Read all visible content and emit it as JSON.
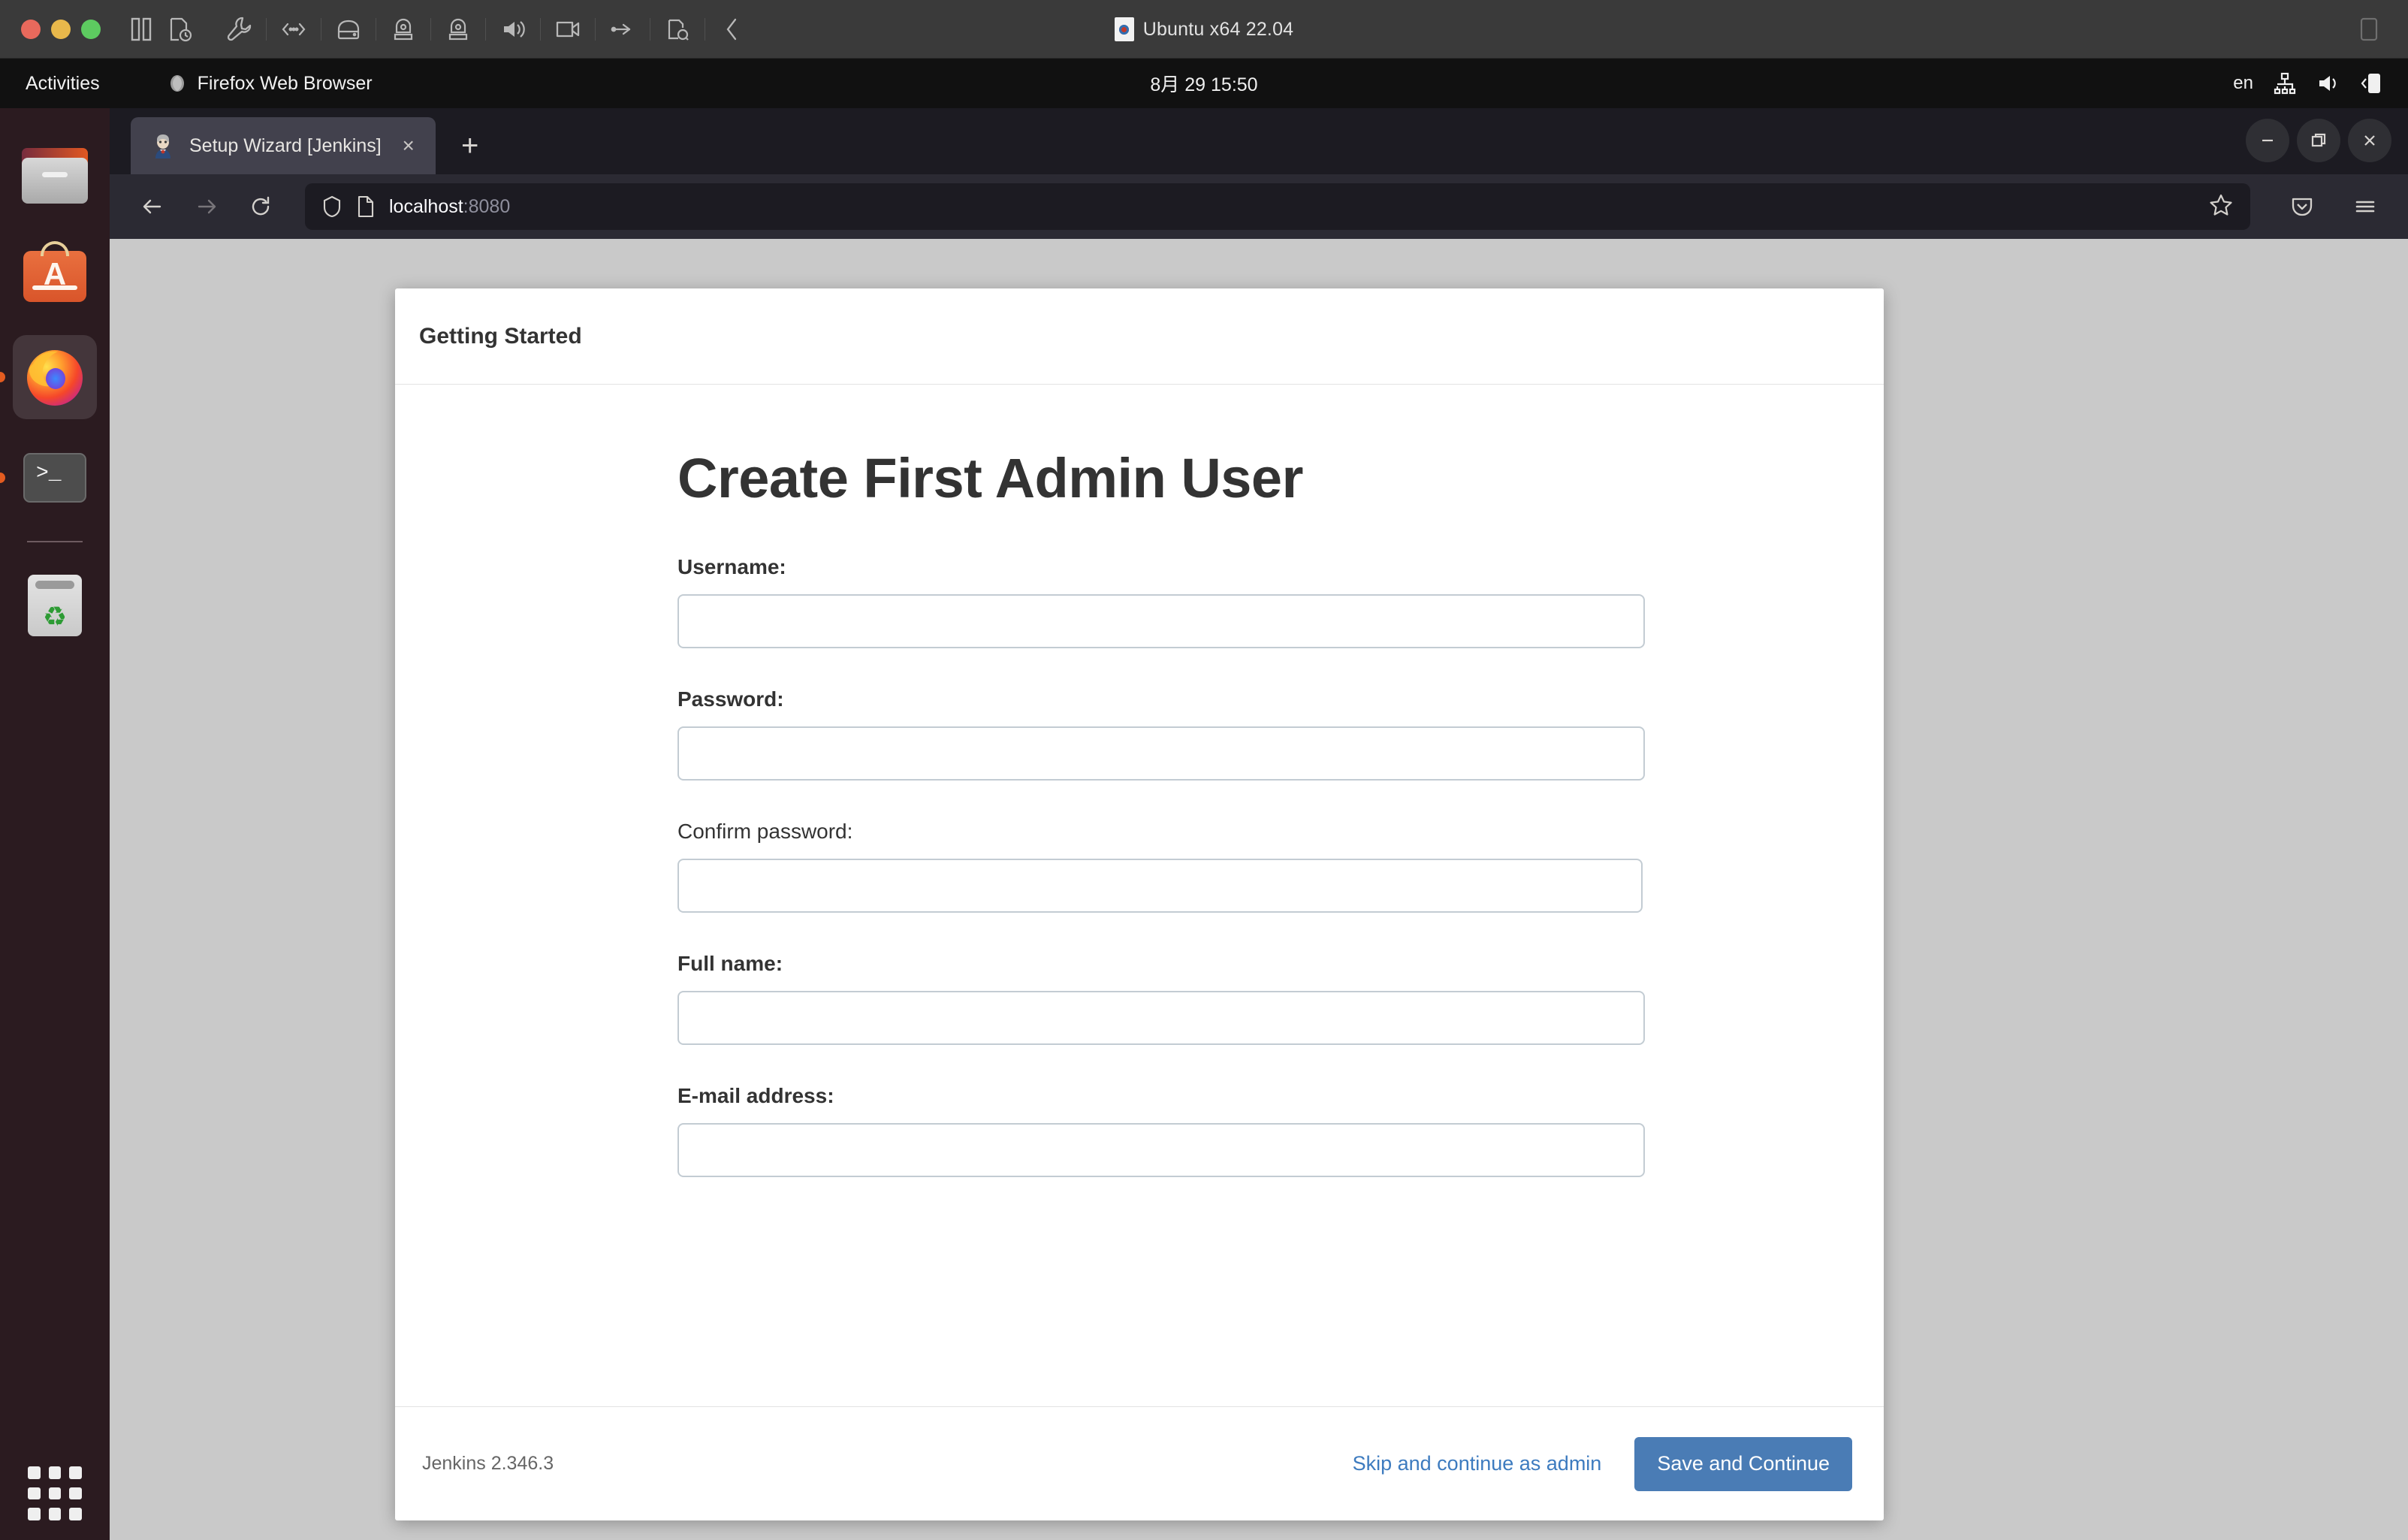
{
  "vmware": {
    "title": "Ubuntu x64 22.04",
    "toolbar_icons": [
      "settings-wrench-icon",
      "network-icon",
      "harddisk-icon",
      "cdrom-icon",
      "cdrom-alt-icon",
      "sound-icon",
      "camera-icon",
      "usb-icon",
      "printer-icon",
      "collapse-icon"
    ],
    "traffic_lights": [
      "close",
      "minimize",
      "maximize"
    ],
    "view_icons": [
      "split-view-icon",
      "snapshot-icon"
    ]
  },
  "gnome": {
    "activities": "Activities",
    "app_name": "Firefox Web Browser",
    "clock": "8月 29  15:50",
    "language": "en",
    "status_icons": [
      "network-icon",
      "volume-icon",
      "battery-icon"
    ]
  },
  "dock": {
    "items": [
      {
        "name": "files",
        "running": false
      },
      {
        "name": "ubuntu-software",
        "running": false
      },
      {
        "name": "firefox",
        "running": true
      },
      {
        "name": "terminal",
        "running": true
      },
      {
        "name": "trash",
        "running": false
      }
    ],
    "app_grid": "show-applications"
  },
  "firefox": {
    "tab": {
      "title": "Setup Wizard [Jenkins]",
      "favicon": "jenkins-butler-icon",
      "close": "×"
    },
    "new_tab": "+",
    "window_controls": {
      "minimize": "—",
      "maximize": "▢",
      "close": "✕"
    },
    "nav": {
      "back": "back-icon",
      "forward": "forward-icon",
      "reload": "reload-icon",
      "shield": "shield-icon",
      "page": "page-icon",
      "url_host": "localhost",
      "url_port": ":8080",
      "url_full": "localhost:8080",
      "bookmark": "star-icon",
      "pocket": "pocket-icon",
      "menu": "hamburger-menu-icon"
    }
  },
  "jenkins": {
    "header_title": "Getting Started",
    "page_title": "Create First Admin User",
    "fields": [
      {
        "label": "Username:",
        "value": "",
        "placeholder": "",
        "bold": true,
        "type": "text",
        "name": "username"
      },
      {
        "label": "Password:",
        "value": "",
        "placeholder": "",
        "bold": true,
        "type": "password",
        "name": "password"
      },
      {
        "label": "Confirm password:",
        "value": "",
        "placeholder": "",
        "bold": false,
        "type": "password",
        "name": "confirm-password"
      },
      {
        "label": "Full name:",
        "value": "",
        "placeholder": "",
        "bold": true,
        "type": "text",
        "name": "fullname"
      },
      {
        "label": "E-mail address:",
        "value": "",
        "placeholder": "",
        "bold": true,
        "type": "text",
        "name": "email"
      }
    ],
    "footer": {
      "version": "Jenkins 2.346.3",
      "skip_link": "Skip and continue as admin",
      "save_button": "Save and Continue"
    },
    "colors": {
      "primary_button": "#4a7cb5",
      "link": "#3d7bbf",
      "page_background": "#c9c9c9",
      "card_background": "#ffffff",
      "input_border": "#c3ccd3"
    }
  }
}
